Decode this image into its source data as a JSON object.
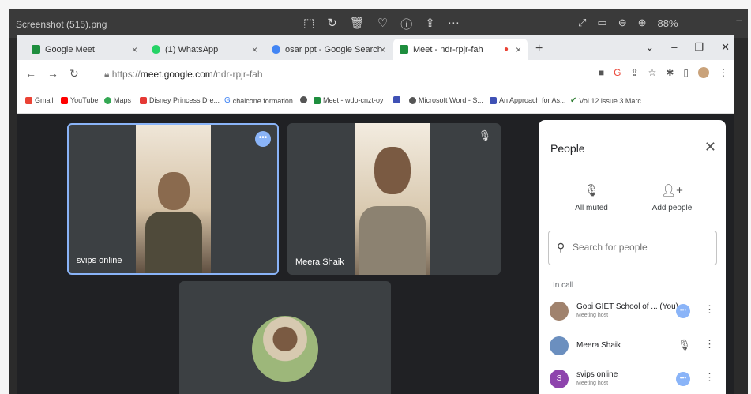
{
  "viewer": {
    "title": "Screenshot (515).png",
    "zoom": "88%",
    "tools": [
      "⬚",
      "↻",
      "🗑",
      "♡",
      "ⓘ",
      "⇪",
      "···"
    ]
  },
  "tabs": [
    {
      "label": "Google Meet",
      "color": "#1e8e3e"
    },
    {
      "label": "(1) WhatsApp",
      "color": "#25d366"
    },
    {
      "label": "osar ppt - Google Search",
      "color": "#4285f4"
    },
    {
      "label": "Meet - ndr-rpjr-fah",
      "color": "#1e8e3e"
    }
  ],
  "url": {
    "prefix": "https://",
    "domain": "meet.google.com",
    "path": "/ndr-rpjr-fah"
  },
  "bookmarks": [
    {
      "label": "Gmail",
      "color": "#ea4335"
    },
    {
      "label": "YouTube",
      "color": "#ff0000"
    },
    {
      "label": "Maps",
      "color": "#34a853"
    },
    {
      "label": "Disney Princess Dre...",
      "color": "#e53935"
    },
    {
      "label": "chalcone formation...",
      "color": "#4285f4"
    },
    {
      "label": "",
      "color": "#555"
    },
    {
      "label": "Meet - wdo-cnzt-oy",
      "color": "#1e8e3e"
    },
    {
      "label": "",
      "color": "#3f51b5"
    },
    {
      "label": "Microsoft Word - S...",
      "color": "#555"
    },
    {
      "label": "An Approach for As...",
      "color": "#3f51b5"
    },
    {
      "label": "Vol 12 issue 3 Marc...",
      "color": "#2e7d32"
    }
  ],
  "tiles": {
    "t1_name": "svips online",
    "t2_name": "Meera Shaik"
  },
  "people": {
    "title": "People",
    "all_muted": "All muted",
    "add_people": "Add people",
    "search_placeholder": "Search for people",
    "section": "In call",
    "list": [
      {
        "name": "Gopi GIET School of ... (You)",
        "role": "Meeting host",
        "avatar_color": "#a0826d"
      },
      {
        "name": "Meera Shaik",
        "role": "",
        "avatar_color": "#6b8fbf"
      },
      {
        "name": "svips online",
        "role": "Meeting host",
        "avatar_color": "#8e44ad",
        "initial": "S"
      }
    ]
  },
  "colors": {
    "accent": "#8ab4f8",
    "meet_bg": "#202124",
    "tile_border": "#8ab4f8"
  }
}
